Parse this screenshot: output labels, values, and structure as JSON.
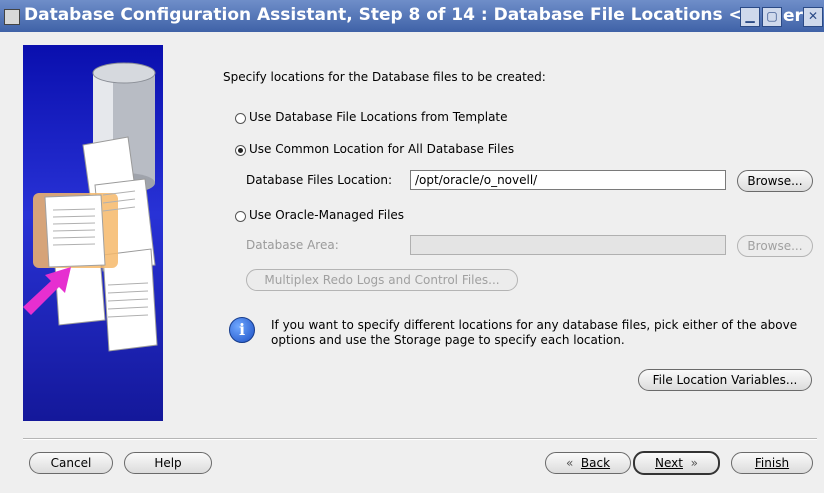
{
  "window": {
    "title": "Database Configuration Assistant, Step 8 of 14 : Database File Locations <@",
    "title_tail": "er"
  },
  "main": {
    "heading": "Specify locations for the Database files to be created:",
    "options": [
      {
        "label": "Use Database File Locations from Template",
        "selected": false
      },
      {
        "label": "Use Common Location for All Database Files",
        "selected": true
      },
      {
        "label": "Use Oracle-Managed Files",
        "selected": false
      }
    ],
    "files_location_label": "Database Files Location:",
    "files_location_value": "/opt/oracle/o_novell/",
    "browse_label": "Browse...",
    "db_area_label": "Database Area:",
    "db_area_value": "",
    "browse_disabled_label": "Browse...",
    "multiplex_label": "Multiplex Redo Logs and Control Files...",
    "info_text": "If you want to specify different locations for any database files, pick either of the above options and use the Storage page to specify each location.",
    "file_location_variables_label": "File Location Variables..."
  },
  "footer": {
    "cancel": "Cancel",
    "help": "Help",
    "back": "Back",
    "next": "Next",
    "finish": "Finish"
  },
  "colors": {
    "titlebar": "#4a6db2",
    "banner": "#1a1fbf",
    "arrow": "#e62fd0"
  }
}
